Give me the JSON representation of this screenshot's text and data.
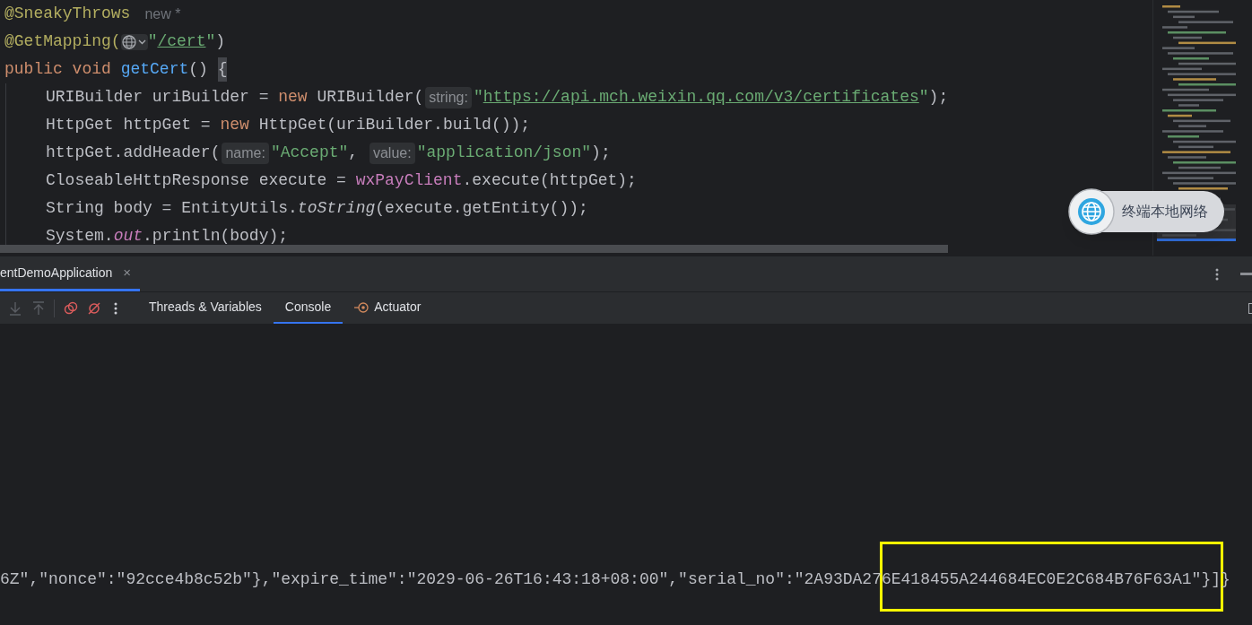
{
  "editor": {
    "lines": [
      {
        "indented": false,
        "tokens": [
          {
            "kind": "annotation",
            "text": "@SneakyThrows"
          },
          {
            "kind": "inlay",
            "text": "new *"
          }
        ]
      },
      {
        "indented": false,
        "tokens": [
          {
            "kind": "annotation",
            "text": "@GetMapping("
          },
          {
            "kind": "globe"
          },
          {
            "kind": "string",
            "text": "\""
          },
          {
            "kind": "link",
            "text": "/cert"
          },
          {
            "kind": "string",
            "text": "\""
          },
          {
            "kind": "plain",
            "text": ")"
          }
        ]
      },
      {
        "indented": false,
        "tokens": [
          {
            "kind": "keyword",
            "text": "public void "
          },
          {
            "kind": "method",
            "text": "getCert"
          },
          {
            "kind": "plain",
            "text": "() "
          },
          {
            "kind": "brace",
            "text": "{"
          }
        ]
      },
      {
        "indented": true,
        "tokens": [
          {
            "kind": "plain",
            "text": "URIBuilder uriBuilder = "
          },
          {
            "kind": "keyword",
            "text": "new "
          },
          {
            "kind": "plain",
            "text": "URIBuilder("
          },
          {
            "kind": "hint",
            "text": "string:"
          },
          {
            "kind": "string",
            "text": "\""
          },
          {
            "kind": "link",
            "text": "https://api.mch.weixin.qq.com/v3/certificates"
          },
          {
            "kind": "string",
            "text": "\""
          },
          {
            "kind": "plain",
            "text": ");"
          }
        ]
      },
      {
        "indented": true,
        "tokens": [
          {
            "kind": "plain",
            "text": "HttpGet httpGet = "
          },
          {
            "kind": "keyword",
            "text": "new "
          },
          {
            "kind": "plain",
            "text": "HttpGet(uriBuilder.build());"
          }
        ]
      },
      {
        "indented": true,
        "tokens": [
          {
            "kind": "plain",
            "text": "httpGet.addHeader("
          },
          {
            "kind": "hint",
            "text": "name:"
          },
          {
            "kind": "string",
            "text": "\"Accept\""
          },
          {
            "kind": "plain",
            "text": ", "
          },
          {
            "kind": "hint",
            "text": "value:"
          },
          {
            "kind": "string",
            "text": "\"application/json\""
          },
          {
            "kind": "plain",
            "text": ");"
          }
        ]
      },
      {
        "indented": true,
        "tokens": [
          {
            "kind": "plain",
            "text": "CloseableHttpResponse execute = "
          },
          {
            "kind": "field",
            "text": "wxPayClient"
          },
          {
            "kind": "plain",
            "text": ".execute(httpGet);"
          }
        ]
      },
      {
        "indented": true,
        "tokens": [
          {
            "kind": "plain",
            "text": "String body = EntityUtils."
          },
          {
            "kind": "static",
            "text": "toString"
          },
          {
            "kind": "plain",
            "text": "(execute.getEntity());"
          }
        ]
      },
      {
        "indented": true,
        "tokens": [
          {
            "kind": "plain",
            "text": "System."
          },
          {
            "kind": "staticfield",
            "text": "out"
          },
          {
            "kind": "plain",
            "text": ".println(body);"
          }
        ]
      }
    ]
  },
  "network_badge": {
    "label": "终端本地网络"
  },
  "run_tab": {
    "label": "entDemoApplication",
    "close": "×",
    "selected": true
  },
  "tool_tabs": [
    {
      "label": "Threads & Variables",
      "selected": false,
      "kind": "plain"
    },
    {
      "label": "Console",
      "selected": true,
      "kind": "plain"
    },
    {
      "label": "Actuator",
      "selected": false,
      "kind": "actuator"
    }
  ],
  "console": {
    "lines": [
      "6Z\",\"nonce\":\"92cce4b8c52b\"},\"expire_time\":\"2029-06-26T16:43:18+08:00\",\"serial_no\":\"2A93DA276E418455A244684EC0E2C684B76F63A1\"}]}"
    ]
  }
}
